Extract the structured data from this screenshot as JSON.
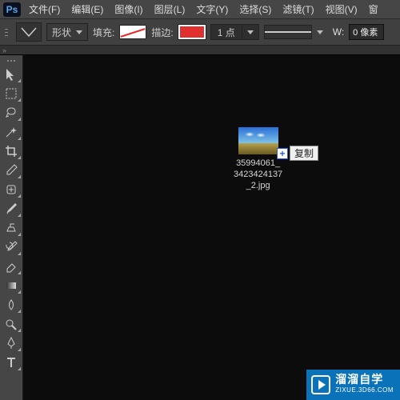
{
  "app": {
    "logo": "Ps"
  },
  "menu": {
    "items": [
      {
        "label": "文件(F)"
      },
      {
        "label": "编辑(E)"
      },
      {
        "label": "图像(I)"
      },
      {
        "label": "图层(L)"
      },
      {
        "label": "文字(Y)"
      },
      {
        "label": "选择(S)"
      },
      {
        "label": "滤镜(T)"
      },
      {
        "label": "视图(V)"
      },
      {
        "label": "窗"
      }
    ]
  },
  "options": {
    "mode_label": "形状",
    "fill_label": "填充:",
    "stroke_label": "描边:",
    "stroke_size": "1 点",
    "w_label": "W:",
    "w_value": "0 像素"
  },
  "canvas_file": {
    "line1": "35994061_",
    "line2": "3423424137",
    "line3": "_2.jpg"
  },
  "drag_action": {
    "plus": "+",
    "label": "复制"
  },
  "watermark": {
    "cn": "溜溜自学",
    "en": "ZIXUE.3D66.COM"
  },
  "tools": [
    {
      "name": "move-tool"
    },
    {
      "name": "marquee-tool"
    },
    {
      "name": "lasso-tool"
    },
    {
      "name": "magic-wand-tool"
    },
    {
      "name": "crop-tool"
    },
    {
      "name": "eyedropper-tool"
    },
    {
      "name": "healing-brush-tool"
    },
    {
      "name": "brush-tool"
    },
    {
      "name": "clone-stamp-tool"
    },
    {
      "name": "history-brush-tool"
    },
    {
      "name": "eraser-tool"
    },
    {
      "name": "gradient-tool"
    },
    {
      "name": "blur-tool"
    },
    {
      "name": "dodge-tool"
    },
    {
      "name": "pen-tool"
    },
    {
      "name": "type-tool"
    }
  ]
}
